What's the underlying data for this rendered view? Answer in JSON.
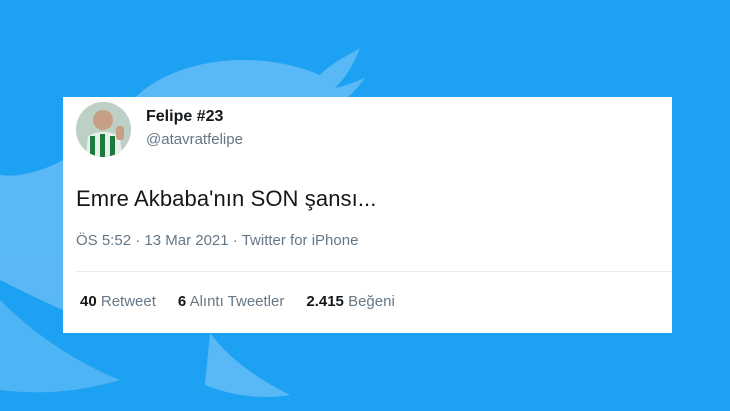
{
  "colors": {
    "background": "#1da1f2",
    "card": "#ffffff",
    "primary_text": "#14171a",
    "secondary_text": "#657786"
  },
  "user": {
    "display_name": "Felipe #23",
    "handle": "@atavratfelipe",
    "avatar_icon": "profile-photo"
  },
  "tweet": {
    "text": "Emre Akbaba'nın SON şansı...",
    "time": "ÖS 5:52",
    "separator": " · ",
    "date": "13 Mar 2021",
    "source": "Twitter for iPhone"
  },
  "stats": {
    "retweets_count": "40",
    "retweets_label": "Retweet",
    "quotes_count": "6",
    "quotes_label": "Alıntı Tweetler",
    "likes_count": "2.415",
    "likes_label": "Beğeni"
  }
}
